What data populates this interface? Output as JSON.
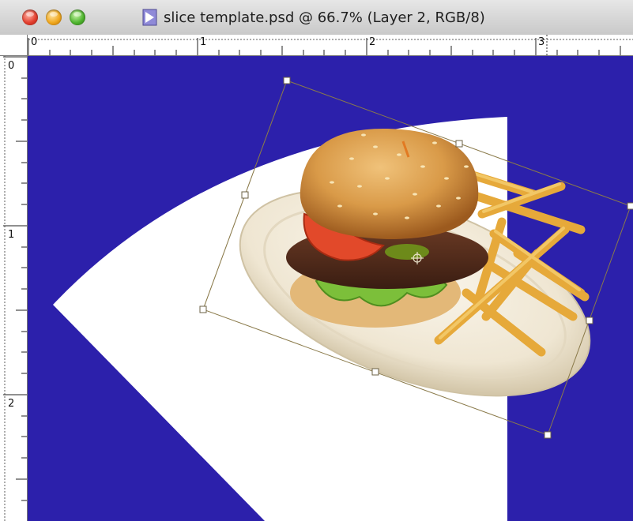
{
  "window": {
    "title": "slice template.psd @ 66.7% (Layer 2, RGB/8)"
  },
  "rulers": {
    "horizontal_labels": [
      "0",
      "1",
      "2",
      "3"
    ],
    "vertical_labels": [
      "0",
      "1",
      "2"
    ]
  },
  "colors": {
    "canvas_background": "#2c20ab",
    "slice_shape": "#ffffff",
    "transform_box": "#8a7a4a"
  },
  "icons": {
    "close": "close-window-icon",
    "minimize": "minimize-window-icon",
    "zoom": "zoom-window-icon",
    "document": "psd-document-icon",
    "pivot": "transform-pivot-icon"
  }
}
